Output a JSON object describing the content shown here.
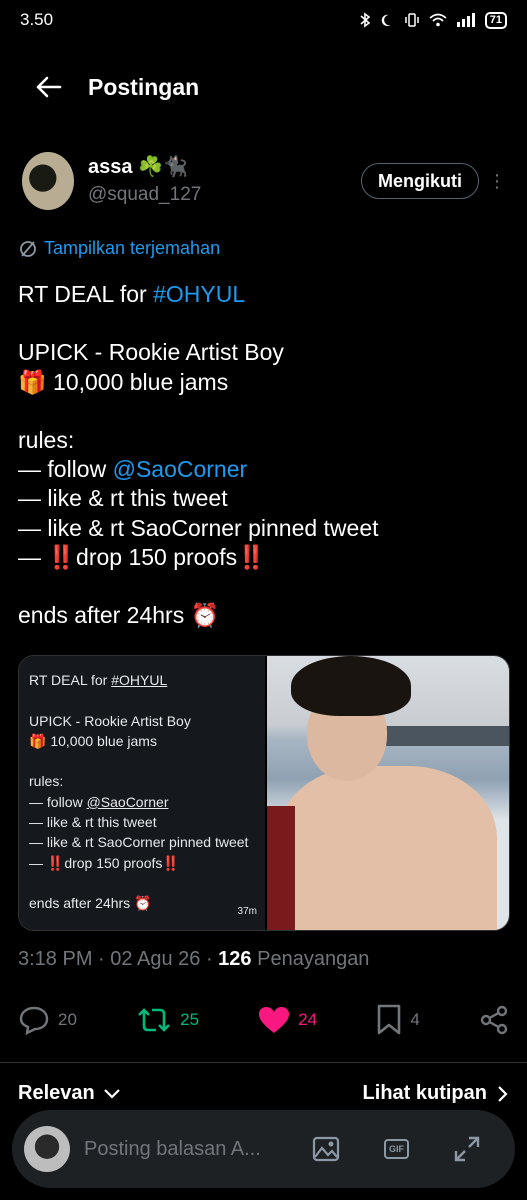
{
  "status_bar": {
    "time": "3.50",
    "battery": "71"
  },
  "header": {
    "title": "Postingan"
  },
  "author": {
    "name": "assa ☘️🐈‍⬛",
    "handle": "@squad_127",
    "follow_label": "Mengikuti",
    "more": "⋮"
  },
  "translate_label": "Tampilkan terjemahan",
  "tweet": {
    "line1_prefix": "RT DEAL for ",
    "hashtag": "#OHYUL",
    "line2": "UPICK - Rookie Artist Boy",
    "line3": "🎁 10,000 blue jams",
    "rules_label": "rules:",
    "rule1_prefix": "— follow ",
    "mention": "@SaoCorner",
    "rule2": "— like & rt this tweet",
    "rule3": "— like & rt SaoCorner pinned tweet",
    "rule4": "— ‼️drop 150 proofs‼️",
    "ends": "ends after 24hrs ⏰"
  },
  "media": {
    "line1_prefix": "RT DEAL for ",
    "hashtag": "#OHYUL",
    "line2": "UPICK - Rookie Artist Boy",
    "line3": "🎁 10,000 blue jams",
    "rules_label": "rules:",
    "rule1_prefix": "— follow ",
    "mention": "@SaoCorner",
    "rule2": "— like & rt this tweet",
    "rule3": "— like & rt SaoCorner pinned tweet",
    "rule4": "— ‼️drop 150 proofs‼️",
    "ends": "ends after 24hrs ⏰",
    "time": "37m"
  },
  "meta": {
    "time": "3:18 PM",
    "date": "02 Agu 26",
    "views": "126",
    "views_label": "Penayangan",
    "separator": "·"
  },
  "actions": {
    "replies": "20",
    "retweets": "25",
    "likes": "24",
    "bookmarks": "4"
  },
  "sort": {
    "left": "Relevan",
    "right": "Lihat kutipan"
  },
  "reply_bar": {
    "placeholder": "Posting balasan A..."
  },
  "colors": {
    "accent": "#1d9bf0",
    "retweet": "#00ba7c",
    "like": "#f91880",
    "muted": "#71767b"
  }
}
